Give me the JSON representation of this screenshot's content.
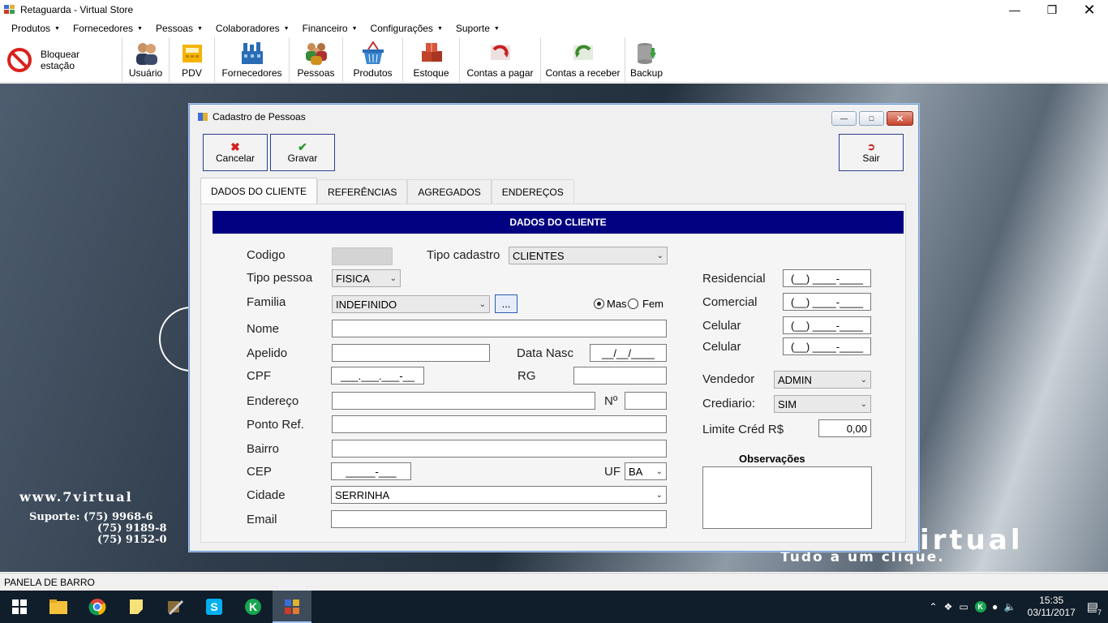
{
  "window": {
    "title": "Retaguarda - Virtual Store"
  },
  "menu": [
    "Produtos",
    "Fornecedores",
    "Pessoas",
    "Colaboradores",
    "Financeiro",
    "Configurações",
    "Suporte"
  ],
  "toolbar": {
    "lock_label": "Bloquear estação",
    "items": [
      "Usuário",
      "PDV",
      "Fornecedores",
      "Pessoas",
      "Produtos",
      "Estoque",
      "Contas a pagar",
      "Contas a receber",
      "Backup"
    ]
  },
  "background": {
    "www": "www.7virtual",
    "support_lines": [
      "Suporte: (75) 9968-6",
      "(75) 9189-8",
      "(75) 9152-0"
    ],
    "brand": "irtual",
    "slogan": "Tudo a um clique."
  },
  "status": "PANELA DE BARRO",
  "dialog": {
    "title": "Cadastro de Pessoas",
    "cancel_label": "Cancelar",
    "save_label": "Gravar",
    "exit_label": "Sair",
    "tabs": [
      "DADOS DO CLIENTE",
      "REFERÊNCIAS",
      "AGREGADOS",
      "ENDEREÇOS"
    ],
    "header": "DADOS DO CLIENTE",
    "labels": {
      "codigo": "Codigo",
      "tipo_cadastro": "Tipo cadastro",
      "tipo_pessoa": "Tipo pessoa",
      "familia": "Familia",
      "nome": "Nome",
      "apelido": "Apelido",
      "data_nasc": "Data Nasc",
      "cpf": "CPF",
      "rg": "RG",
      "endereco": "Endereço",
      "numero": "Nº",
      "ponto_ref": "Ponto Ref.",
      "bairro": "Bairro",
      "cep": "CEP",
      "uf": "UF",
      "cidade": "Cidade",
      "email": "Email",
      "residencial": "Residencial",
      "comercial": "Comercial",
      "celular1": "Celular",
      "celular2": "Celular",
      "vendedor": "Vendedor",
      "crediario": "Crediario:",
      "limite": "Limite Créd R$",
      "observacoes": "Observações"
    },
    "values": {
      "tipo_cadastro": "CLIENTES",
      "tipo_pessoa": "FISICA",
      "familia": "INDEFINIDO",
      "familia_btn": "...",
      "sex_m": "Mas",
      "sex_f": "Fem",
      "data_nasc": "__/__/____",
      "cpf": "___.___.___-__",
      "cep": "_____-___",
      "uf": "BA",
      "cidade": "SERRINHA",
      "phone_mask": "(__) ____-____",
      "vendedor": "ADMIN",
      "crediario": "SIM",
      "limite": "0,00"
    }
  },
  "clock": {
    "time": "15:35",
    "date": "03/11/2017"
  },
  "notifications": "7"
}
